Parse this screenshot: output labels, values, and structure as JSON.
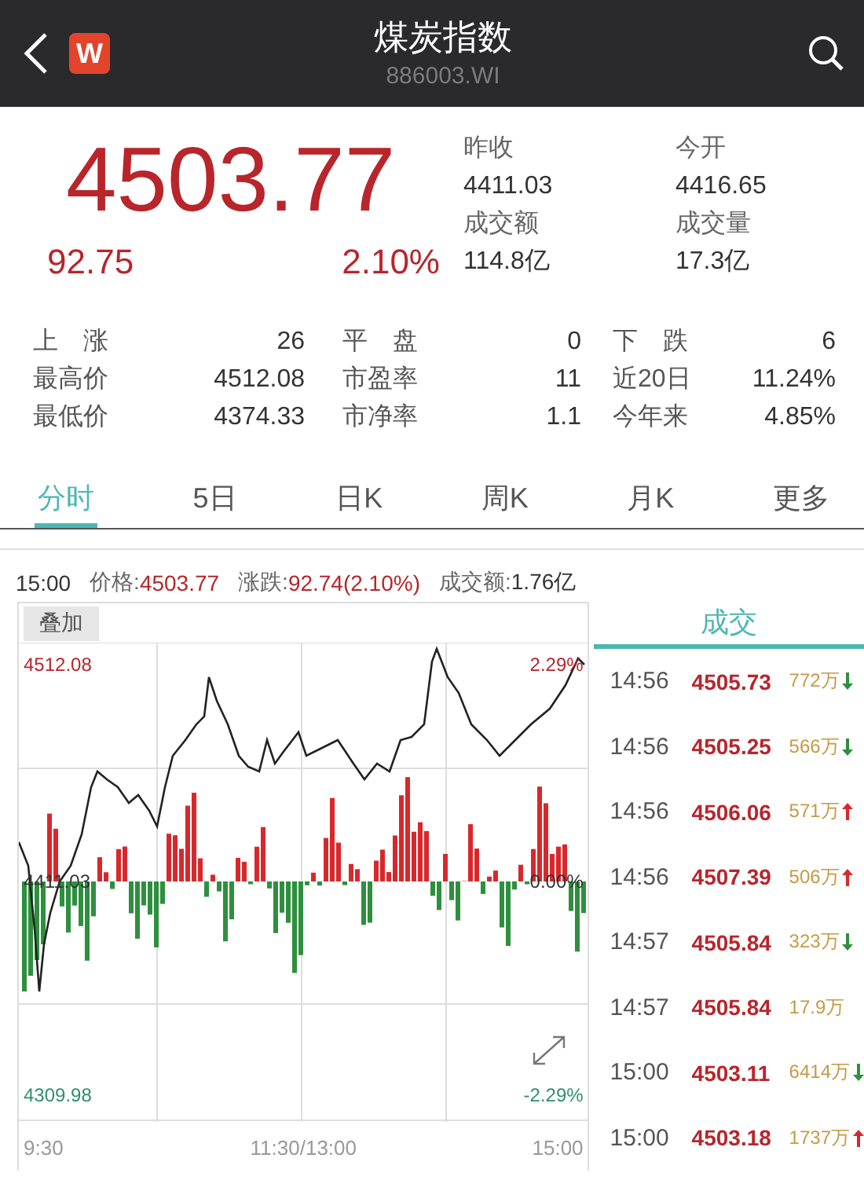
{
  "header": {
    "logo": "W",
    "title": "煤炭指数",
    "code": "886003.WI"
  },
  "quote": {
    "price": "4503.77",
    "change": "92.75",
    "change_pct": "2.10%"
  },
  "summary": [
    {
      "label": "昨收",
      "value": "4411.03"
    },
    {
      "label": "今开",
      "value": "4416.65"
    },
    {
      "label": "成交额",
      "value": "114.8亿"
    },
    {
      "label": "成交量",
      "value": "17.3亿"
    }
  ],
  "stats": [
    [
      {
        "label": "上涨",
        "value": "26"
      },
      {
        "label": "平盘",
        "value": "0"
      },
      {
        "label": "下跌",
        "value": "6"
      }
    ],
    [
      {
        "label": "最高价",
        "value": "4512.08"
      },
      {
        "label": "市盈率",
        "value": "11"
      },
      {
        "label": "近20日",
        "value": "11.24%"
      }
    ],
    [
      {
        "label": "最低价",
        "value": "4374.33"
      },
      {
        "label": "市净率",
        "value": "1.1"
      },
      {
        "label": "今年来",
        "value": "4.85%"
      }
    ]
  ],
  "tabs": [
    {
      "label": "分时",
      "selected": true
    },
    {
      "label": "5日",
      "selected": false
    },
    {
      "label": "日K",
      "selected": false
    },
    {
      "label": "周K",
      "selected": false
    },
    {
      "label": "月K",
      "selected": false
    },
    {
      "label": "更多",
      "selected": false
    }
  ],
  "info": {
    "time": "15:00",
    "price_label": "价格:",
    "price": "4503.77",
    "change_label": "涨跌:",
    "change": "92.74(2.10%)",
    "amount_label": "成交额:",
    "amount": "1.76亿"
  },
  "chart": {
    "overlay_button": "叠加",
    "high": "4512.08",
    "mid": "4411.03",
    "low": "4309.98",
    "high_pct": "2.29%",
    "mid_pct": "0.00%",
    "low_pct": "-2.29%",
    "x_labels": [
      "9:30",
      "11:30/13:00",
      "15:00"
    ]
  },
  "trades_title": "成交",
  "trades": [
    {
      "time": "14:56",
      "price": "4505.73",
      "volume": "772万",
      "kind": "down"
    },
    {
      "time": "14:56",
      "price": "4505.25",
      "volume": "566万",
      "kind": "down"
    },
    {
      "time": "14:56",
      "price": "4506.06",
      "volume": "571万",
      "kind": "up"
    },
    {
      "time": "14:56",
      "price": "4507.39",
      "volume": "506万",
      "kind": "up"
    },
    {
      "time": "14:57",
      "price": "4505.84",
      "volume": "323万",
      "kind": "down"
    },
    {
      "time": "14:57",
      "price": "4505.84",
      "volume": "17.9万",
      "kind": "plain"
    },
    {
      "time": "15:00",
      "price": "4503.11",
      "volume": "6414万",
      "kind": "down"
    },
    {
      "time": "15:00",
      "price": "4503.18",
      "volume": "1737万",
      "kind": "up"
    }
  ]
}
